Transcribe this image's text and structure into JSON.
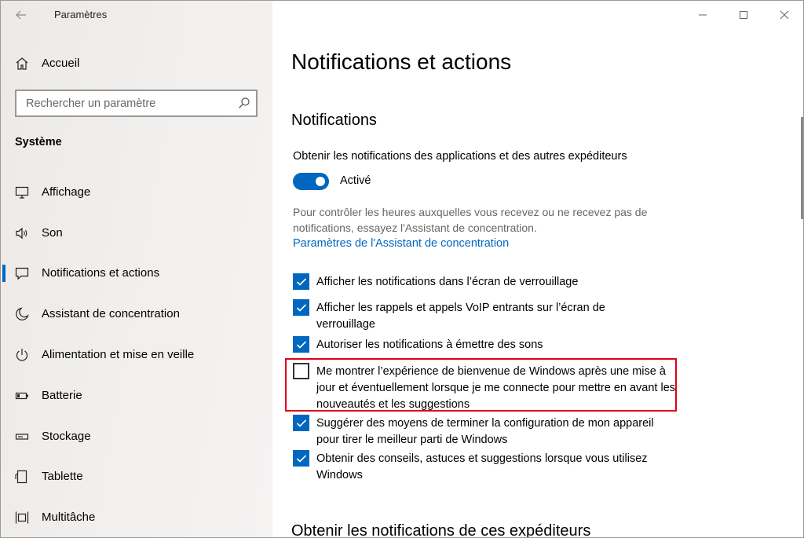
{
  "window": {
    "app_title": "Paramètres",
    "controls": [
      "minimize",
      "maximize",
      "close"
    ]
  },
  "sidebar": {
    "home_label": "Accueil",
    "search_placeholder": "Rechercher un paramètre",
    "section_label": "Système",
    "items": [
      {
        "label": "Affichage",
        "icon": "display-icon",
        "selected": false
      },
      {
        "label": "Son",
        "icon": "speaker-icon",
        "selected": false
      },
      {
        "label": "Notifications et actions",
        "icon": "notification-icon",
        "selected": true
      },
      {
        "label": "Assistant de concentration",
        "icon": "moon-icon",
        "selected": false
      },
      {
        "label": "Alimentation et mise en veille",
        "icon": "power-icon",
        "selected": false
      },
      {
        "label": "Batterie",
        "icon": "battery-icon",
        "selected": false
      },
      {
        "label": "Stockage",
        "icon": "storage-icon",
        "selected": false
      },
      {
        "label": "Tablette",
        "icon": "tablet-icon",
        "selected": false
      },
      {
        "label": "Multitâche",
        "icon": "multitask-icon",
        "selected": false
      }
    ]
  },
  "main": {
    "page_title": "Notifications et actions",
    "notifications_section": {
      "title": "Notifications",
      "toggle_caption": "Obtenir les notifications des applications et des autres expéditeurs",
      "toggle_state_label": "Activé",
      "toggle_on": true,
      "description": "Pour contrôler les heures auxquelles vous recevez ou ne recevez pas de notifications, essayez l'Assistant de concentration.",
      "description_line1": "Pour contrôler les heures auxquelles vous recevez ou ne recevez pas de",
      "description_line2": "notifications, essayez l'Assistant de concentration.",
      "link": "Paramètres de l'Assistant de concentration",
      "checkboxes": [
        {
          "label": "Afficher les notifications dans l’écran de verrouillage",
          "checked": true
        },
        {
          "label": "Afficher les rappels et appels VoIP entrants sur l’écran de verrouillage",
          "checked": true
        },
        {
          "label": "Autoriser les notifications à émettre des sons",
          "checked": true
        },
        {
          "label": "Me montrer l’expérience de bienvenue de Windows après une mise à jour et éventuellement lorsque je me connecte pour mettre en avant les nouveautés et les suggestions",
          "checked": false
        },
        {
          "label": "Suggérer des moyens de terminer la configuration de mon appareil pour tirer le meilleur parti de Windows",
          "checked": true
        },
        {
          "label": "Obtenir des conseils, astuces et suggestions lorsque vous utilisez Windows",
          "checked": true
        }
      ]
    },
    "senders_section": {
      "title": "Obtenir les notifications de ces expéditeurs"
    }
  },
  "colors": {
    "accent": "#0067c0",
    "highlight_box": "#e0001a",
    "sidebar_bg": "#eeece9"
  }
}
